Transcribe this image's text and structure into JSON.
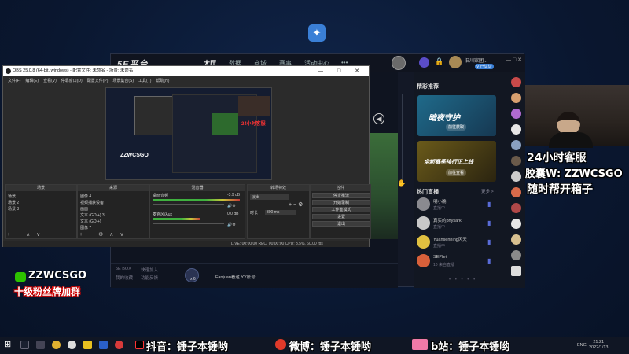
{
  "platform": {
    "nav": {
      "home": "大厅",
      "data": "数据",
      "mall": "商城",
      "events": "赛事",
      "activity": "活动中心",
      "more": "•••"
    },
    "username": "旧川家团...",
    "user_badge": "V 已认证",
    "window_controls": "— □ ✕",
    "collapse_icon": "◀",
    "bottom": {
      "link1": "5E BOX",
      "link2": "快速加入",
      "link3": "我的收藏",
      "link4": "功能反馈",
      "gift_count": "x 6",
      "chip_label": "Fanjuan看这 YY账号"
    },
    "right_panel": {
      "section1_title": "精彩推荐",
      "banner1_title": "暗夜守护",
      "banner1_sub": "前往获取",
      "banner2_title": "全新赛季排行正上线",
      "banner2_sub": "前往查看",
      "section2_title": "热门直播",
      "more_label": "更多 >",
      "live": [
        {
          "name": "明小确",
          "status": "直播中"
        },
        {
          "name": "真实的physark",
          "status": "直播中"
        },
        {
          "name": "Yuansenning风天",
          "status": "直播中"
        },
        {
          "name": "SEPfei",
          "status": "10 来自直播"
        }
      ],
      "pager": "• • • • •"
    }
  },
  "overlay": {
    "line1": "24小时客服",
    "line2": "胶囊W: ZZWCSGO",
    "line3": "随时帮开箱子",
    "left_id": "ZZWCSGO",
    "left_sub": "十级粉丝牌加群",
    "bottom_tiktok": "抖音：锤子本锤哟",
    "bottom_weibo": "微博：锤子本锤哟",
    "bottom_bili": "b站：锤子本锤哟"
  },
  "obs": {
    "title": "OBS 25.0.8 (64-bit, windows) - 配置文件: 未命名 - 场景: 未命名",
    "window_controls": "— □ ✕",
    "menu": [
      "文件(F)",
      "编辑(E)",
      "查看(V)",
      "停靠窗口(D)",
      "配置文件(P)",
      "场景集合(S)",
      "工具(T)",
      "帮助(H)"
    ],
    "preview_logo": "ZZWCSGO",
    "preview_red": "24小时客服",
    "docks": {
      "scenes": {
        "title": "场景",
        "items": [
          "场景",
          "场景 2",
          "场景 3"
        ],
        "footer": "+ − ∧ ∨"
      },
      "sources": {
        "title": "来源",
        "items": [
          "图像 4",
          "视频捕获设备",
          "画面",
          "文本 (GDI+) 3",
          "文本 (GDI+)",
          "图像 7"
        ],
        "footer": "+ − ⚙ ∧ ∨"
      },
      "mixer": {
        "title": "混音器",
        "ch1": "桌面音频",
        "ch1_db": "-3.9 dB",
        "ch2": "麦克风/Aux",
        "ch2_db": "0.0 dB"
      },
      "transitions": {
        "title": "转场特效",
        "type": "淡出",
        "duration_label": "时长",
        "duration": "300 ms"
      },
      "controls": {
        "title": "控件",
        "buttons": [
          "停止推流",
          "开始录制",
          "工作室模式",
          "设置",
          "退出"
        ]
      }
    },
    "status": "LIVE: 00:00:00   REC: 00:00:00   CPU: 3.5%, 60.00 fps"
  },
  "taskbar": {
    "lang": "ENG",
    "time": "21:21",
    "date": "2022/1/13"
  }
}
